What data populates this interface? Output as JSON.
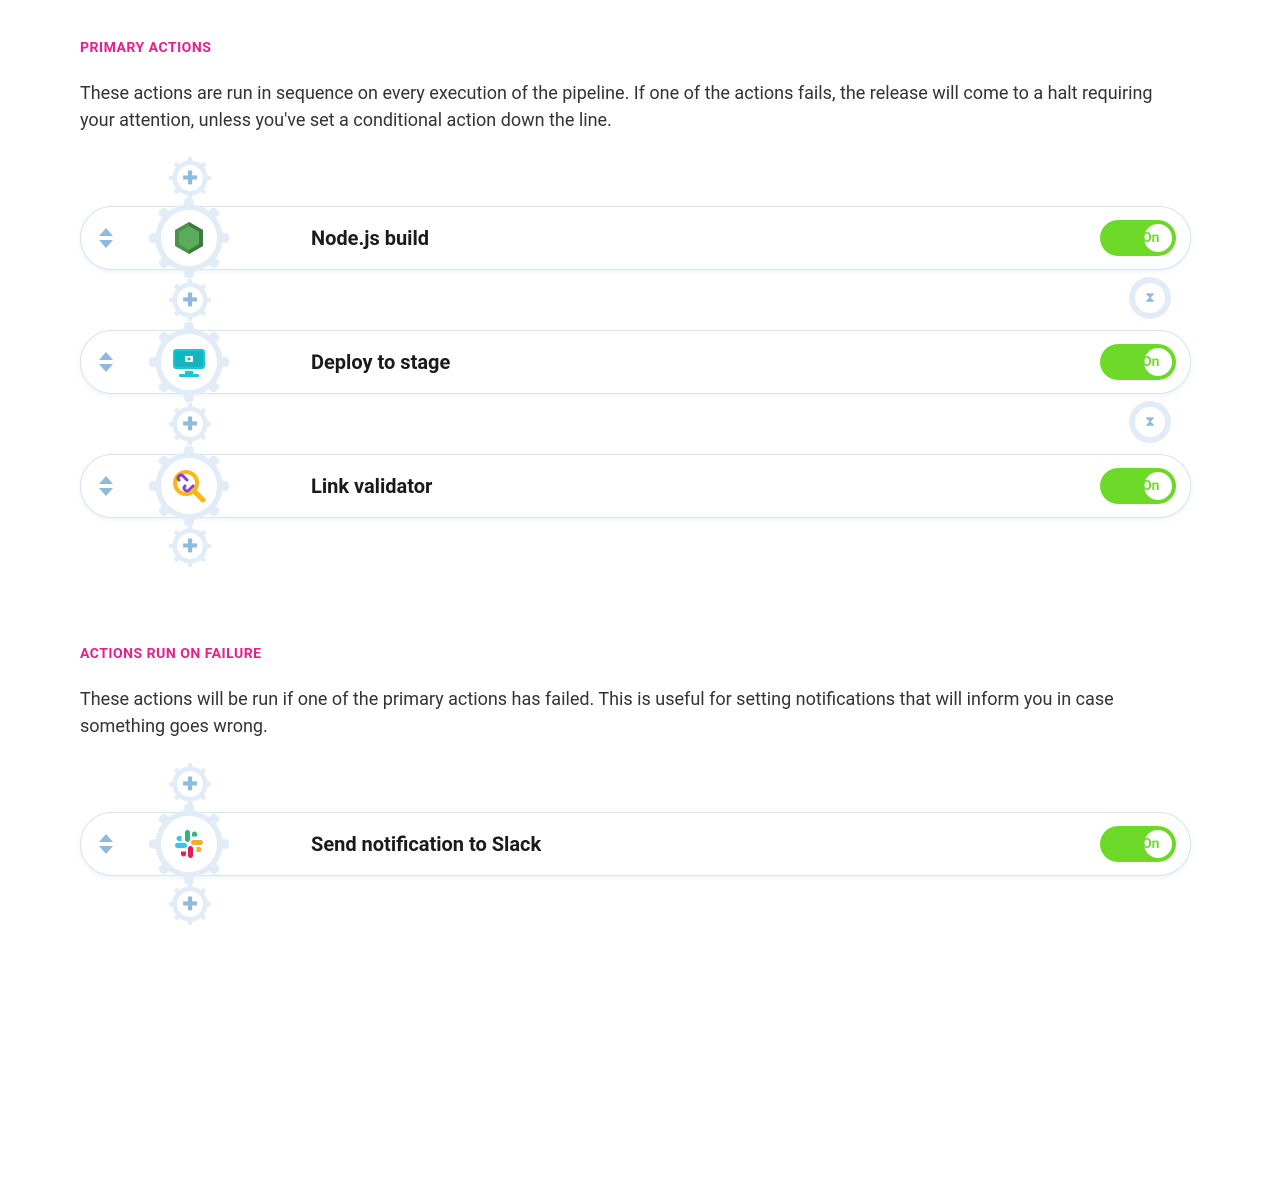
{
  "sections": {
    "primary": {
      "heading": "PRIMARY ACTIONS",
      "description": "These actions are run in sequence on every execution of the pipeline. If one of the actions fails, the release will come to a halt requiring your attention, unless you've set a conditional action down the line.",
      "actions": [
        {
          "title": "Node.js build",
          "toggle": "On",
          "icon": "nodejs"
        },
        {
          "title": "Deploy to stage",
          "toggle": "On",
          "icon": "deploy"
        },
        {
          "title": "Link validator",
          "toggle": "On",
          "icon": "link-validator"
        }
      ]
    },
    "failure": {
      "heading": "ACTIONS RUN ON FAILURE",
      "description": "These actions will be run if one of the primary actions has failed. This is useful for setting notifications that will inform you in case something goes wrong.",
      "actions": [
        {
          "title": "Send notification to Slack",
          "toggle": "On",
          "icon": "slack"
        }
      ]
    }
  }
}
